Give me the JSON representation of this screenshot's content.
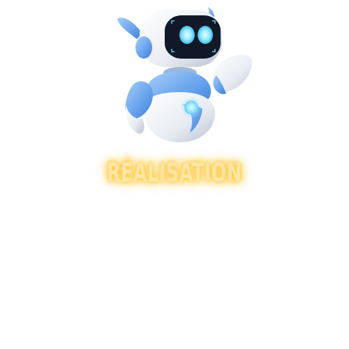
{
  "title": "RÉALISATION",
  "colors": {
    "glow": "#ffc93c",
    "text": "#fde6a6",
    "robot_body": "#f4f6f9",
    "robot_accent": "#6ea8ef",
    "robot_eye": "#8ee9ff",
    "robot_face": "#111827"
  },
  "icons": {
    "mascot": "robot-mascot-icon"
  }
}
